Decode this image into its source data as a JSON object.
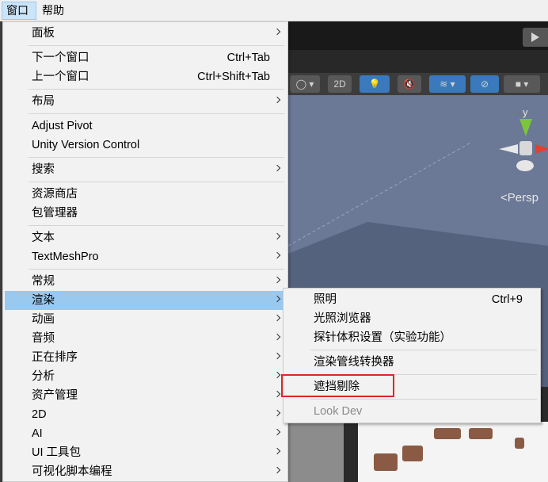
{
  "menubar": {
    "window": "窗口",
    "help": "帮助"
  },
  "toolbar": {
    "mode_2d": "2D"
  },
  "scene": {
    "persp_label": "<Persp",
    "axis_y": "y"
  },
  "window_menu": {
    "items": [
      {
        "label": "面板",
        "submenu": true
      },
      {
        "label": "下一个窗口",
        "shortcut": "Ctrl+Tab"
      },
      {
        "label": "上一个窗口",
        "shortcut": "Ctrl+Shift+Tab"
      },
      {
        "label": "布局",
        "submenu": true
      },
      {
        "label": "Adjust Pivot"
      },
      {
        "label": "Unity Version Control"
      },
      {
        "label": "搜索",
        "submenu": true
      },
      {
        "label": "资源商店"
      },
      {
        "label": "包管理器"
      },
      {
        "label": "文本",
        "submenu": true
      },
      {
        "label": "TextMeshPro",
        "submenu": true
      },
      {
        "label": "常规",
        "submenu": true
      },
      {
        "label": "渲染",
        "submenu": true,
        "highlighted": true
      },
      {
        "label": "动画",
        "submenu": true
      },
      {
        "label": "音频",
        "submenu": true
      },
      {
        "label": "正在排序",
        "submenu": true
      },
      {
        "label": "分析",
        "submenu": true
      },
      {
        "label": "资产管理",
        "submenu": true
      },
      {
        "label": "2D",
        "submenu": true
      },
      {
        "label": "AI",
        "submenu": true
      },
      {
        "label": "UI 工具包",
        "submenu": true
      },
      {
        "label": "可视化脚本编程",
        "submenu": true
      }
    ]
  },
  "render_submenu": {
    "items": [
      {
        "label": "照明",
        "shortcut": "Ctrl+9"
      },
      {
        "label": "光照浏览器"
      },
      {
        "label": "探针体积设置（实验功能）"
      },
      {
        "label": "渲染管线转换器"
      },
      {
        "label": "遮挡剔除",
        "annotated": true
      },
      {
        "label": "Look Dev",
        "disabled": true
      }
    ]
  },
  "colors": {
    "highlight": "#99c9ef",
    "annotation_box": "#e0262a"
  }
}
